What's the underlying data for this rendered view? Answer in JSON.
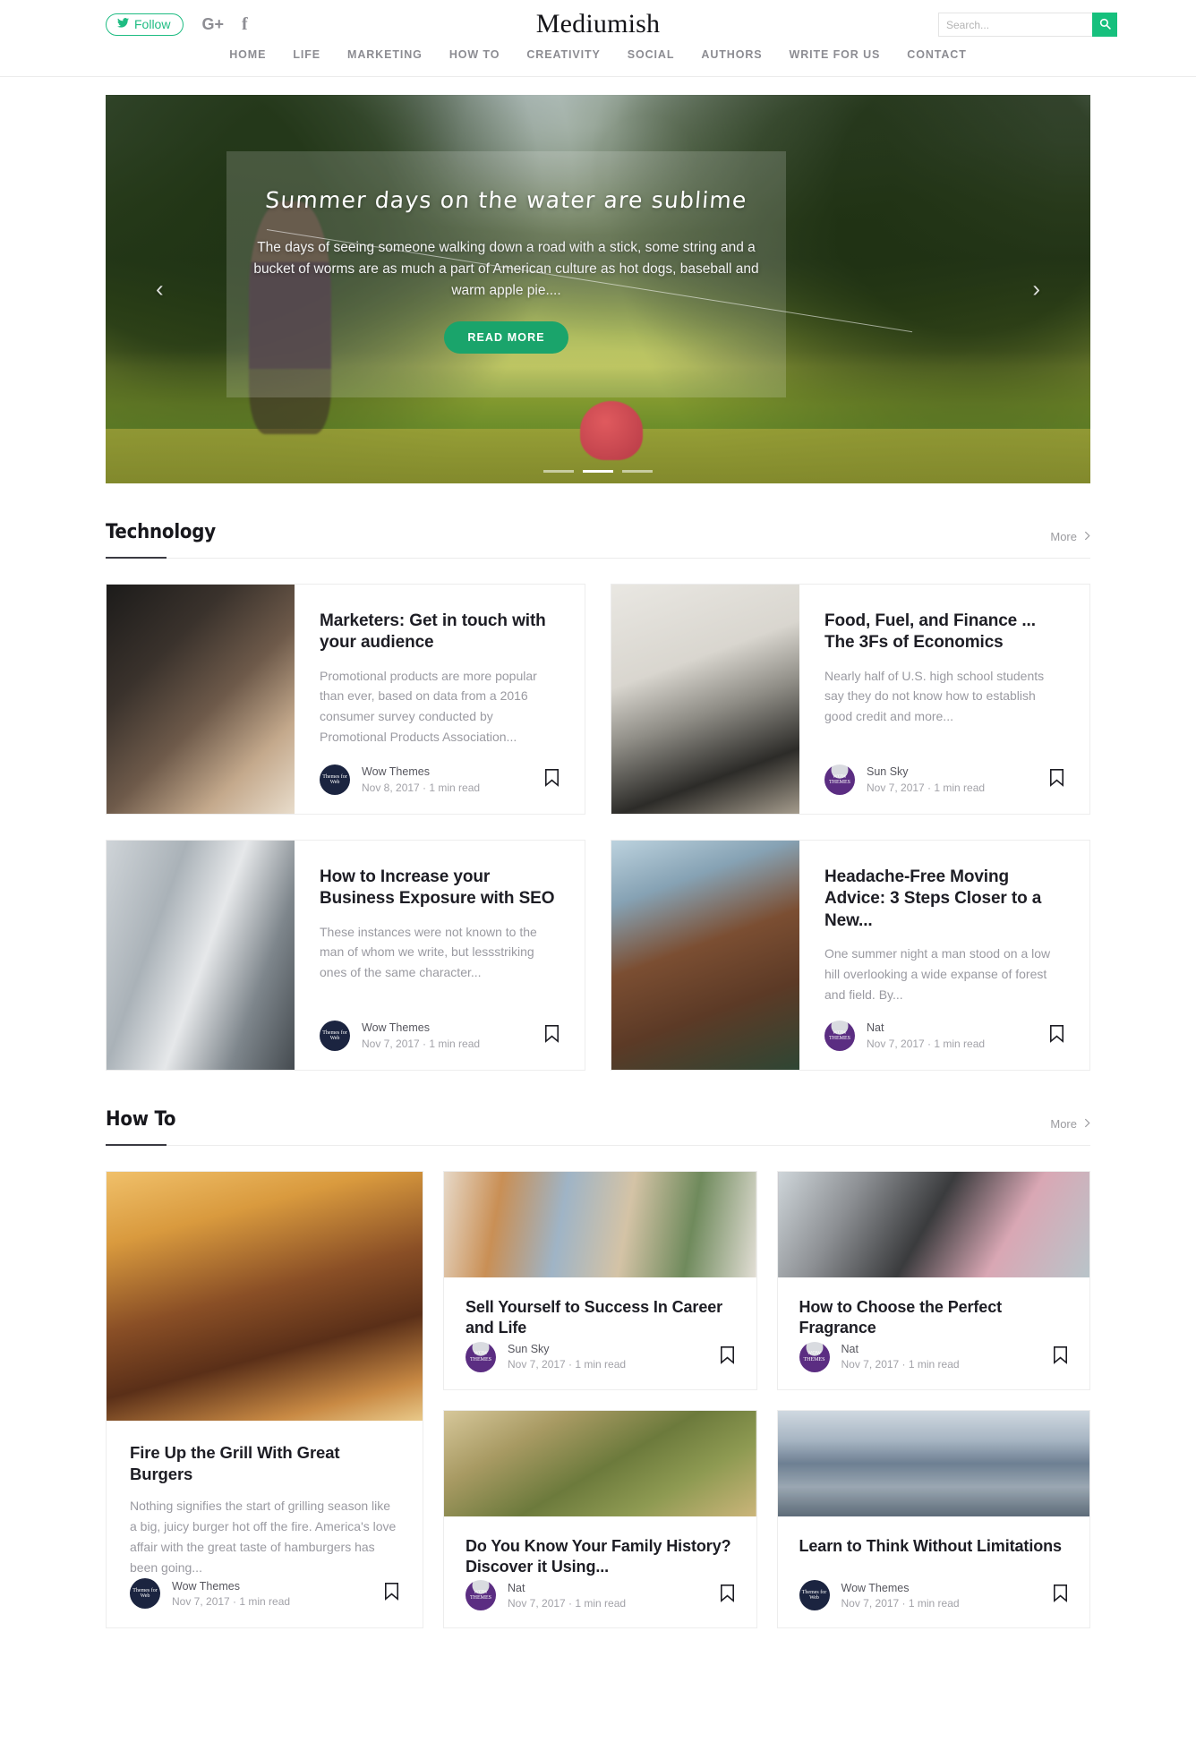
{
  "header": {
    "follow_label": "Follow",
    "twitter_icon": "twitter-icon",
    "googleplus_icon": "google-plus-icon",
    "facebook_icon": "facebook-icon",
    "googleplus_glyph": "G+",
    "facebook_glyph": "f",
    "brand": "Mediumish",
    "search_placeholder": "Search...",
    "search_value": "",
    "search_icon": "search-icon",
    "accent_color": "#16c07d"
  },
  "nav": {
    "items": [
      {
        "label": "HOME"
      },
      {
        "label": "LIFE"
      },
      {
        "label": "MARKETING"
      },
      {
        "label": "HOW TO"
      },
      {
        "label": "CREATIVITY"
      },
      {
        "label": "SOCIAL"
      },
      {
        "label": "AUTHORS"
      },
      {
        "label": "WRITE FOR US"
      },
      {
        "label": "CONTACT"
      }
    ]
  },
  "hero": {
    "title": "Summer days on the water are sublime",
    "description": "The days of seeing someone walking down a road with a stick, some string and a bucket of worms  are as much a part of American culture as hot dogs, baseball and warm apple pie....",
    "button_label": "READ MORE",
    "prev_icon": "chevron-left-icon",
    "next_icon": "chevron-right-icon",
    "dots": 3,
    "active_dot": 1,
    "button_color": "#1aa46b"
  },
  "sections": [
    {
      "title": "Technology",
      "more_label": "More",
      "more_icon": "chevron-right-icon",
      "layout": "horizontal",
      "cards": [
        {
          "title": "Marketers: Get in touch with your audience",
          "excerpt": "Promotional products are more popular than ever, based on data from a 2016 consumer survey conducted by Promotional Products Association...",
          "author": "Wow Themes",
          "date": "Nov 8, 2017",
          "separator": "·",
          "read_time": "1 min read",
          "avatar": "navy",
          "avatar_text": "Themes for Web",
          "thumb": "thumb-hands",
          "bookmark_icon": "bookmark-icon"
        },
        {
          "title": "Food, Fuel, and Finance ... The 3Fs of Economics",
          "excerpt": "Nearly half of U.S. high school students say they do not know how to establish good credit and more...",
          "author": "Sun Sky",
          "date": "Nov 7, 2017",
          "separator": "·",
          "read_time": "1 min read",
          "avatar": "purple",
          "avatar_text": "WOW THEMES",
          "thumb": "thumb-coffee",
          "bookmark_icon": "bookmark-icon"
        },
        {
          "title": "How to Increase your Business Exposure with SEO",
          "excerpt": "These instances were not known to the man of whom we write, but lessstriking ones of the same character...",
          "author": "Wow Themes",
          "date": "Nov 7, 2017",
          "separator": "·",
          "read_time": "1 min read",
          "avatar": "navy",
          "avatar_text": "Themes for Web",
          "thumb": "thumb-office",
          "bookmark_icon": "bookmark-icon"
        },
        {
          "title": "Headache-Free Moving Advice: 3 Steps Closer to a New...",
          "excerpt": "One summer night a man stood on a low hill overlooking a wide expanse of forest and field. By...",
          "author": "Nat",
          "date": "Nov 7, 2017",
          "separator": "·",
          "read_time": "1 min read",
          "avatar": "purple",
          "avatar_text": "WOW THEMES",
          "thumb": "thumb-cabin",
          "bookmark_icon": "bookmark-icon"
        }
      ]
    },
    {
      "title": "How To",
      "more_label": "More",
      "more_icon": "chevron-right-icon",
      "layout": "vertical",
      "cards": [
        {
          "title": "Fire Up the Grill With Great Burgers",
          "excerpt": "Nothing signifies the start of grilling season like a big, juicy burger hot off the fire. America's love affair with the great taste of hamburgers has been going...",
          "author": "Wow Themes",
          "date": "Nov 7, 2017",
          "separator": "·",
          "read_time": "1 min read",
          "avatar": "navy",
          "avatar_text": "Themes for Web",
          "thumb": "thumb-burger",
          "bookmark_icon": "bookmark-icon"
        },
        {
          "title": "Sell Yourself to Success In Career and Life",
          "excerpt": "",
          "author": "Sun Sky",
          "date": "Nov 7, 2017",
          "separator": "·",
          "read_time": "1 min read",
          "avatar": "purple",
          "avatar_text": "WOW THEMES",
          "thumb": "thumb-paint",
          "bookmark_icon": "bookmark-icon"
        },
        {
          "title": "How to Choose the Perfect Fragrance",
          "excerpt": "",
          "author": "Nat",
          "date": "Nov 7, 2017",
          "separator": "·",
          "read_time": "1 min read",
          "avatar": "purple",
          "avatar_text": "WOW THEMES",
          "thumb": "thumb-flower",
          "bookmark_icon": "bookmark-icon"
        },
        {
          "title": "Do You Know Your Family History? Discover it Using...",
          "excerpt": "",
          "author": "Nat",
          "date": "Nov 7, 2017",
          "separator": "·",
          "read_time": "1 min read",
          "avatar": "purple",
          "avatar_text": "WOW THEMES",
          "thumb": "thumb-field",
          "bookmark_icon": "bookmark-icon"
        },
        {
          "title": "Learn to Think Without Limitations",
          "excerpt": "",
          "author": "Wow Themes",
          "date": "Nov 7, 2017",
          "separator": "·",
          "read_time": "1 min read",
          "avatar": "navy",
          "avatar_text": "Themes for Web",
          "thumb": "thumb-sky",
          "bookmark_icon": "bookmark-icon"
        }
      ]
    }
  ]
}
